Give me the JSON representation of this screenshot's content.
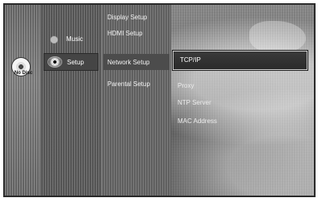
{
  "disc": {
    "status": "No Disc",
    "icon": "disc-icon"
  },
  "nav": {
    "items": [
      {
        "label": "Music",
        "icon": "music-icon",
        "selected": false
      },
      {
        "label": "Setup",
        "icon": "gear-icon",
        "selected": true
      }
    ]
  },
  "submenu": {
    "items": [
      {
        "label": "Display Setup"
      },
      {
        "label": "HDMI Setup"
      },
      {
        "label": "Network Setup",
        "selected": true
      },
      {
        "label": "Parental Setup"
      }
    ]
  },
  "options": {
    "items": [
      {
        "label": "TCP/IP",
        "selected": true
      },
      {
        "label": "Proxy"
      },
      {
        "label": "NTP Server"
      },
      {
        "label": "MAC Address"
      }
    ]
  }
}
